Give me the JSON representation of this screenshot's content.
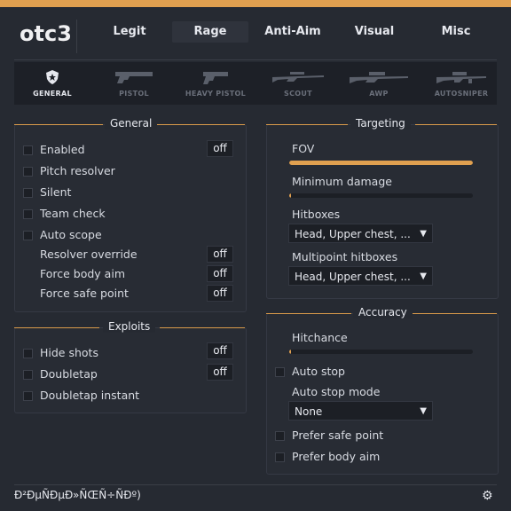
{
  "app": {
    "logo": "otc3",
    "footer_text": "Ð²ÐµÑÐµÐ»ÑŒÑ÷ÑÐº)"
  },
  "tabs": [
    {
      "label": "Legit",
      "active": false
    },
    {
      "label": "Rage",
      "active": true
    },
    {
      "label": "Anti-Aim",
      "active": false
    },
    {
      "label": "Visual",
      "active": false
    },
    {
      "label": "Misc",
      "active": false
    }
  ],
  "weapons": [
    {
      "label": "GENERAL",
      "icon": "shield-icon",
      "active": true
    },
    {
      "label": "PISTOL",
      "icon": "pistol-icon",
      "active": false
    },
    {
      "label": "HEAVY PISTOL",
      "icon": "heavy-pistol-icon",
      "active": false
    },
    {
      "label": "SCOUT",
      "icon": "scout-rifle-icon",
      "active": false
    },
    {
      "label": "AWP",
      "icon": "awp-rifle-icon",
      "active": false
    },
    {
      "label": "AUTOSNIPER",
      "icon": "autosniper-icon",
      "active": false
    }
  ],
  "general": {
    "title": "General",
    "enabled": {
      "label": "Enabled",
      "bind": "off"
    },
    "pitch_resolver": {
      "label": "Pitch resolver"
    },
    "silent": {
      "label": "Silent"
    },
    "team_check": {
      "label": "Team check"
    },
    "auto_scope": {
      "label": "Auto scope"
    },
    "resolver_override": {
      "label": "Resolver override",
      "bind": "off"
    },
    "force_body_aim": {
      "label": "Force body aim",
      "bind": "off"
    },
    "force_safe_point": {
      "label": "Force safe point",
      "bind": "off"
    }
  },
  "exploits": {
    "title": "Exploits",
    "hide_shots": {
      "label": "Hide shots",
      "bind": "off"
    },
    "doubletap": {
      "label": "Doubletap",
      "bind": "off"
    },
    "doubletap_instant": {
      "label": "Doubletap instant"
    }
  },
  "targeting": {
    "title": "Targeting",
    "fov": {
      "label": "FOV",
      "value": 1.0
    },
    "minimum_damage": {
      "label": "Minimum damage",
      "value": 0.01
    },
    "hitboxes": {
      "label": "Hitboxes",
      "value": "Head, Upper chest, ..."
    },
    "multipoint_hitboxes": {
      "label": "Multipoint hitboxes",
      "value": "Head, Upper chest, ..."
    }
  },
  "accuracy": {
    "title": "Accuracy",
    "hitchance": {
      "label": "Hitchance",
      "value": 0.01
    },
    "auto_stop": {
      "label": "Auto stop"
    },
    "auto_stop_mode": {
      "label": "Auto stop mode",
      "value": "None"
    },
    "prefer_safe_point": {
      "label": "Prefer safe point"
    },
    "prefer_body_aim": {
      "label": "Prefer body aim"
    }
  },
  "colors": {
    "accent": "#e0a050",
    "background": "#262a32"
  }
}
